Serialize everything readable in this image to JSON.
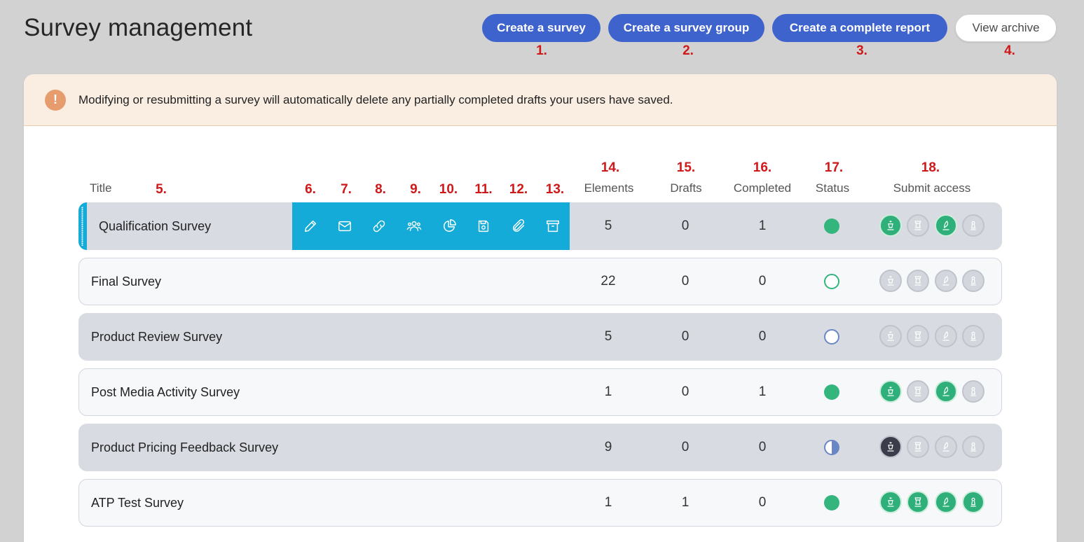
{
  "page": {
    "title": "Survey management"
  },
  "toolbar": {
    "create_survey": "Create a survey",
    "create_group": "Create a survey group",
    "create_report": "Create a complete report",
    "view_archive": "View archive"
  },
  "markers": [
    "1.",
    "2.",
    "3.",
    "4.",
    "5.",
    "6.",
    "7.",
    "8.",
    "9.",
    "10.",
    "11.",
    "12.",
    "13.",
    "14.",
    "15.",
    "16.",
    "17.",
    "18."
  ],
  "alert": {
    "icon": "!",
    "text": "Modifying or resubmitting a survey will automatically delete any partially completed drafts your users have saved."
  },
  "table": {
    "headers": {
      "title": "Title",
      "elements": "Elements",
      "drafts": "Drafts",
      "completed": "Completed",
      "status": "Status",
      "access": "Submit access"
    },
    "action_icons": [
      "pencil-icon",
      "envelope-icon",
      "link-icon",
      "users-icon",
      "pie-chart-icon",
      "save-icon",
      "paperclip-icon",
      "archive-icon"
    ],
    "rows": [
      {
        "title": "Qualification Survey",
        "elements": "5",
        "drafts": "0",
        "completed": "1",
        "status": "done",
        "access": [
          "on",
          "off",
          "on",
          "off"
        ]
      },
      {
        "title": "Final Survey",
        "elements": "22",
        "drafts": "0",
        "completed": "0",
        "status": "open-green",
        "access": [
          "off",
          "off",
          "off",
          "off"
        ]
      },
      {
        "title": "Product Review Survey",
        "elements": "5",
        "drafts": "0",
        "completed": "0",
        "status": "open-blue",
        "access": [
          "off",
          "off",
          "off",
          "off"
        ]
      },
      {
        "title": "Post Media Activity Survey",
        "elements": "1",
        "drafts": "0",
        "completed": "1",
        "status": "done",
        "access": [
          "on",
          "off",
          "on",
          "off"
        ]
      },
      {
        "title": "Product Pricing Feedback Survey",
        "elements": "9",
        "drafts": "0",
        "completed": "0",
        "status": "half",
        "access": [
          "black",
          "off",
          "off",
          "off"
        ]
      },
      {
        "title": "ATP Test Survey",
        "elements": "1",
        "drafts": "1",
        "completed": "0",
        "status": "done",
        "access": [
          "on",
          "on",
          "on",
          "on"
        ]
      }
    ]
  },
  "colors": {
    "primary": "#3f63cc",
    "action_bar": "#15abd8",
    "success": "#35b57e",
    "marker": "#d01818"
  }
}
